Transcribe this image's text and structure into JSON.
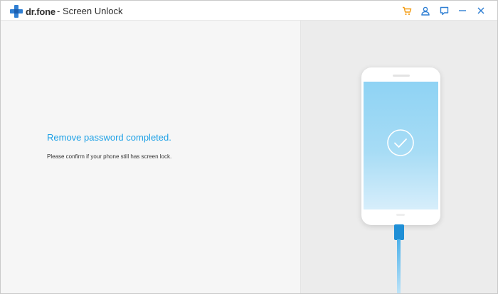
{
  "app": {
    "brand_name": "dr.fone",
    "module_title": "- Screen Unlock"
  },
  "title_actions": [
    {
      "icon": "cart-icon"
    },
    {
      "icon": "user-icon"
    },
    {
      "icon": "feedback-icon"
    },
    {
      "icon": "minimize-icon"
    },
    {
      "icon": "close-icon"
    }
  ],
  "main": {
    "headline": "Remove password completed.",
    "subtext": "Please confirm if your phone still has screen lock."
  },
  "colors": {
    "accent": "#1ea1e6",
    "cart_accent": "#f39c12",
    "brand_blue": "#2f7fd3"
  },
  "illustration": {
    "status_icon": "checkmark-icon",
    "device": "phone",
    "connector": "usb-cable"
  }
}
